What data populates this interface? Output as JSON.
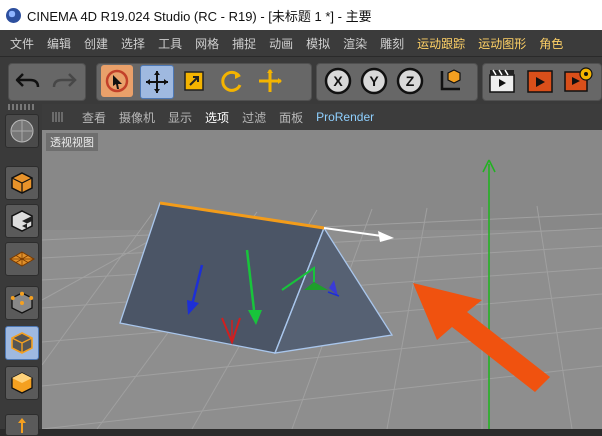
{
  "window": {
    "title": "CINEMA 4D R19.024 Studio (RC - R19) - [未标题 1 *] - 主要"
  },
  "menubar": {
    "items": [
      {
        "label": "文件",
        "highlight": false
      },
      {
        "label": "编辑",
        "highlight": false
      },
      {
        "label": "创建",
        "highlight": false
      },
      {
        "label": "选择",
        "highlight": false
      },
      {
        "label": "工具",
        "highlight": false
      },
      {
        "label": "网格",
        "highlight": false
      },
      {
        "label": "捕捉",
        "highlight": false
      },
      {
        "label": "动画",
        "highlight": false
      },
      {
        "label": "模拟",
        "highlight": false
      },
      {
        "label": "渲染",
        "highlight": false
      },
      {
        "label": "雕刻",
        "highlight": false
      },
      {
        "label": "运动跟踪",
        "highlight": true
      },
      {
        "label": "运动图形",
        "highlight": true
      },
      {
        "label": "角色",
        "highlight": true
      }
    ]
  },
  "toolbar": {
    "axis_labels": {
      "x": "X",
      "y": "Y",
      "z": "Z"
    }
  },
  "viewport": {
    "menu": [
      {
        "label": "查看",
        "state": "normal"
      },
      {
        "label": "摄像机",
        "state": "normal"
      },
      {
        "label": "显示",
        "state": "normal"
      },
      {
        "label": "选项",
        "state": "active"
      },
      {
        "label": "过滤",
        "state": "normal"
      },
      {
        "label": "面板",
        "state": "normal"
      },
      {
        "label": "ProRender",
        "state": "accent"
      }
    ],
    "camera_label": "透视视图",
    "colors": {
      "background": "#8d8d8d",
      "grid": "#a3a3a3",
      "object": "#4a5565",
      "edge": "#aac8ee",
      "highlight_edge": "#f39c1a",
      "axis_y": "#22b322",
      "arrow": "#f0520f"
    }
  }
}
